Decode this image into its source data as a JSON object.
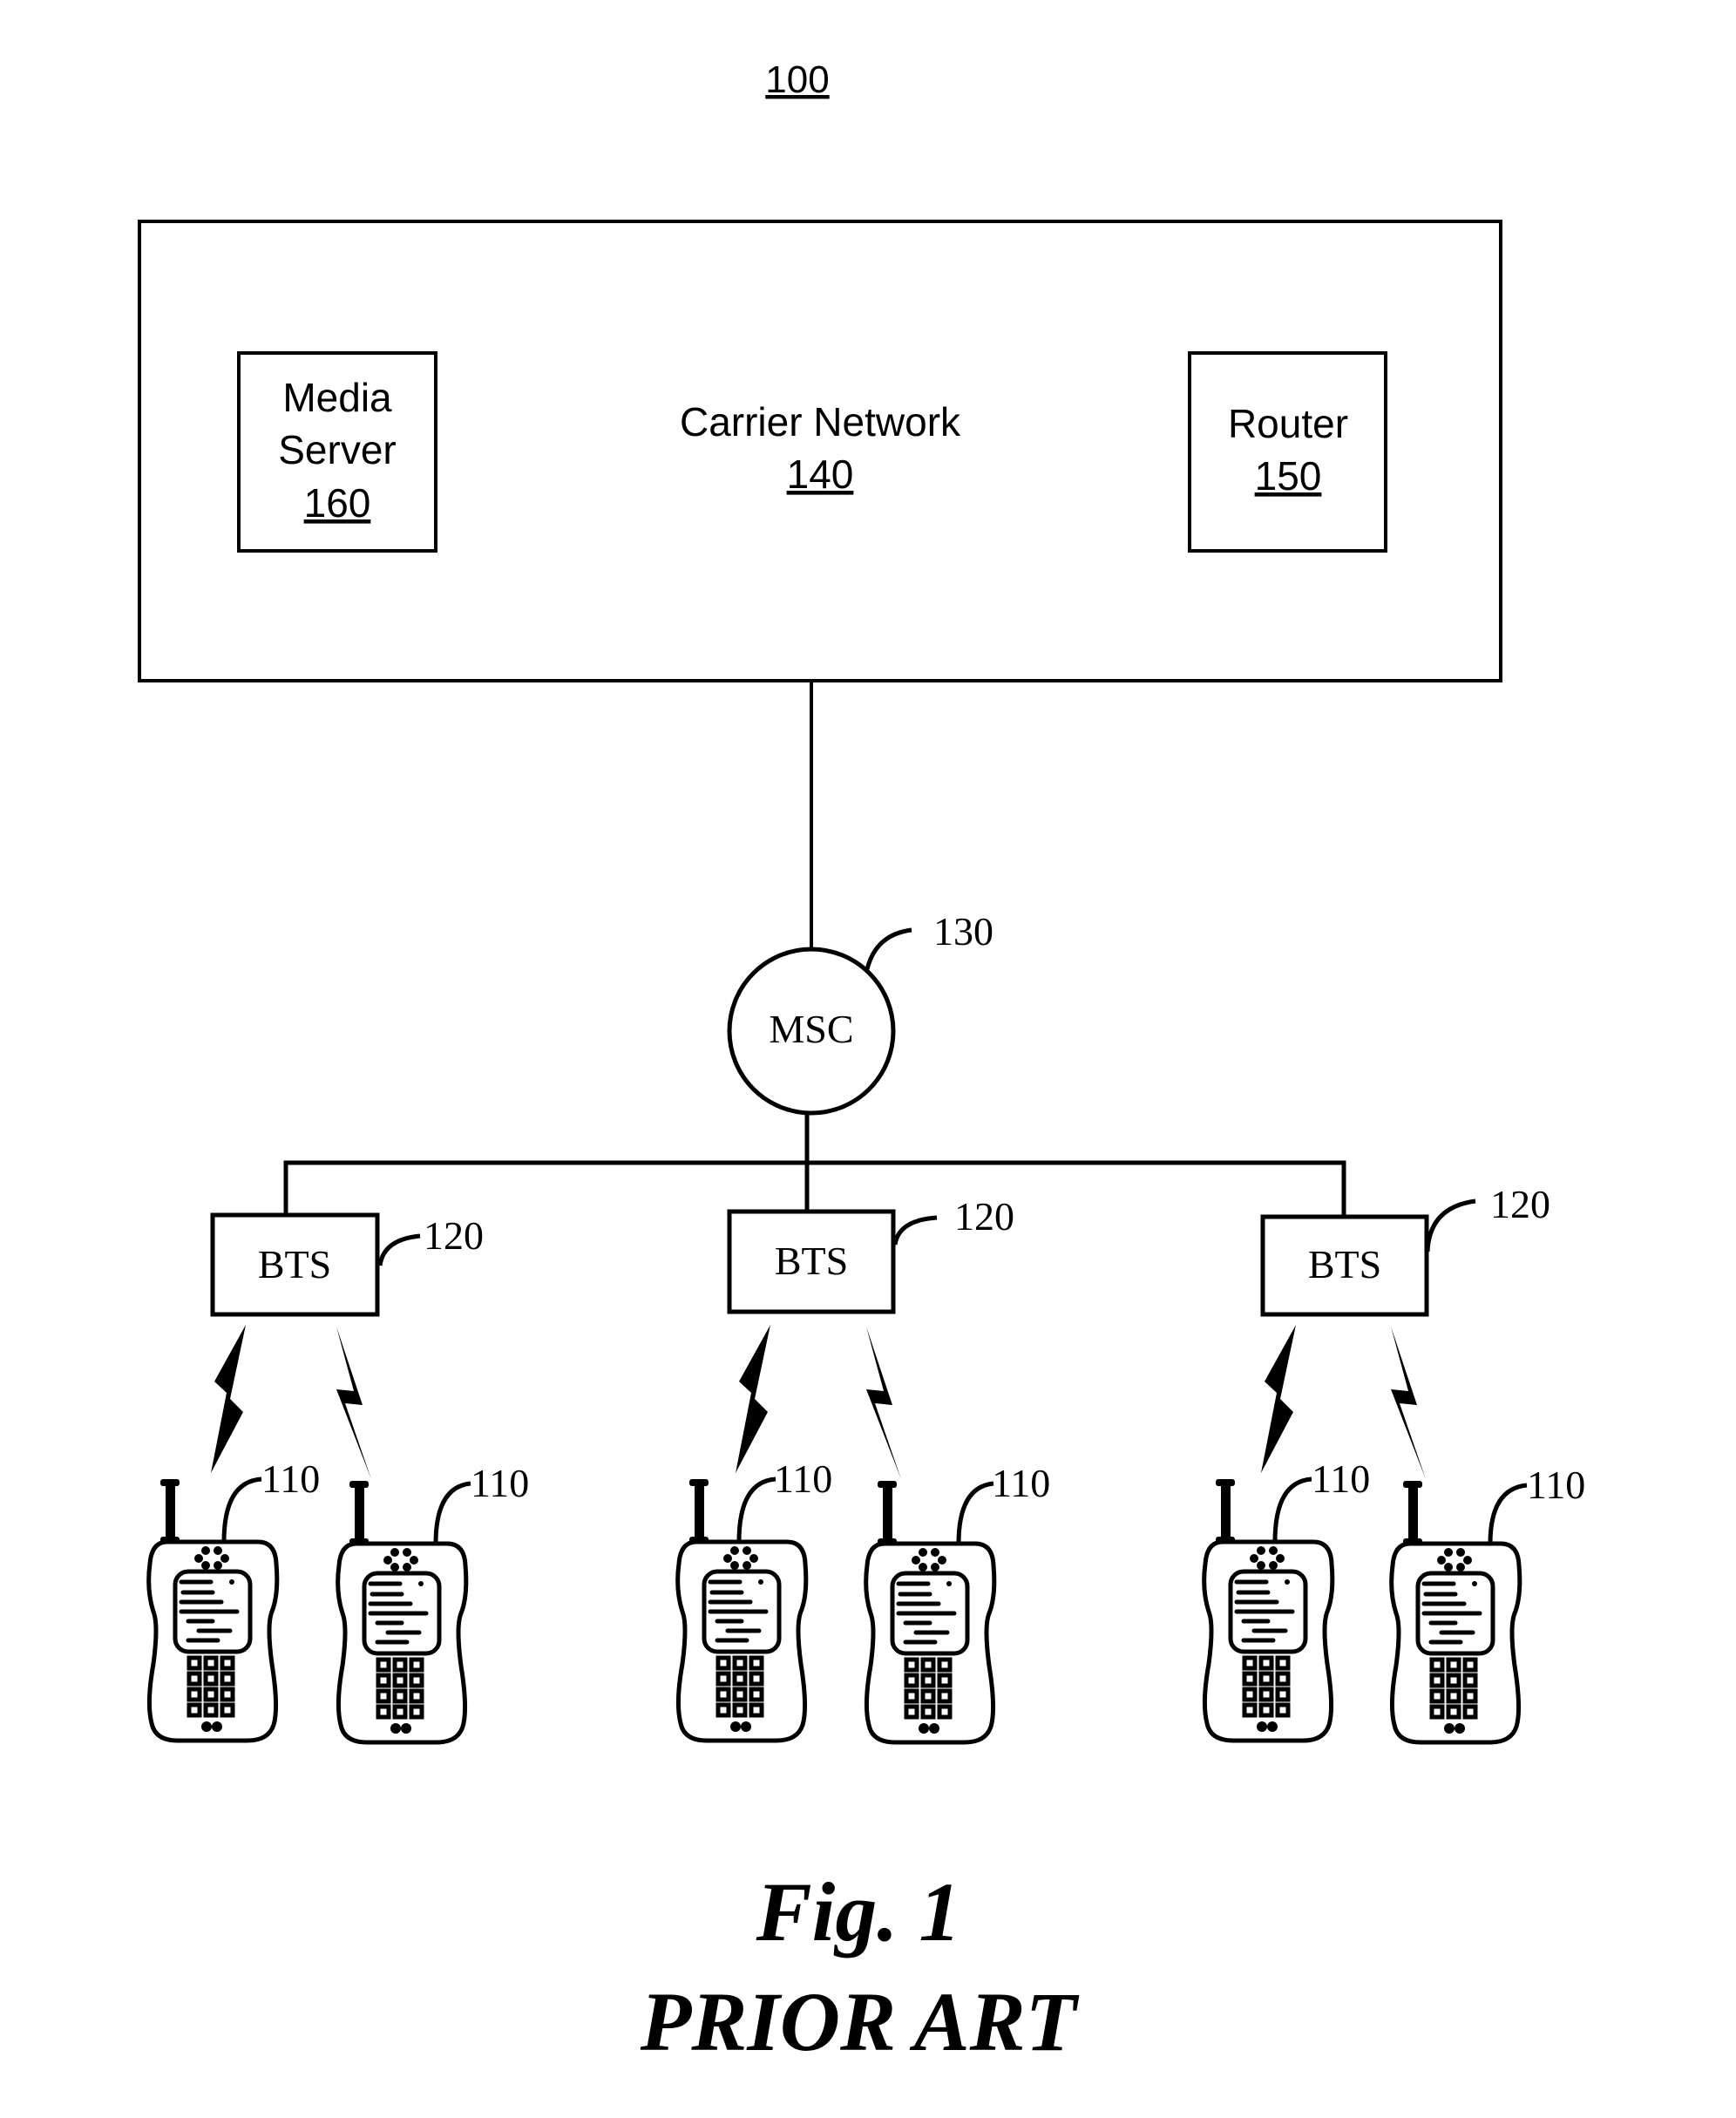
{
  "figure": {
    "ref_number": "100",
    "caption": "Fig. 1",
    "caption_sub": "PRIOR ART",
    "ink_color": "#000000",
    "background_color": "#ffffff"
  },
  "carrier_network": {
    "label": "Carrier Network",
    "ref": "140"
  },
  "media_server": {
    "line1": "Media",
    "line2": "Server",
    "ref": "160"
  },
  "router": {
    "label": "Router",
    "ref": "150"
  },
  "msc": {
    "label": "MSC",
    "ref": "130"
  },
  "bts_stations": [
    {
      "label": "BTS",
      "ref": "120"
    },
    {
      "label": "BTS",
      "ref": "120"
    },
    {
      "label": "BTS",
      "ref": "120"
    }
  ],
  "mobile_devices": [
    {
      "ref": "110",
      "icon": "walkie-talkie-icon"
    },
    {
      "ref": "110",
      "icon": "walkie-talkie-icon"
    },
    {
      "ref": "110",
      "icon": "walkie-talkie-icon"
    },
    {
      "ref": "110",
      "icon": "walkie-talkie-icon"
    },
    {
      "ref": "110",
      "icon": "walkie-talkie-icon"
    },
    {
      "ref": "110",
      "icon": "walkie-talkie-icon"
    }
  ],
  "links": {
    "wireless_icon": "lightning-bolt-icon"
  }
}
